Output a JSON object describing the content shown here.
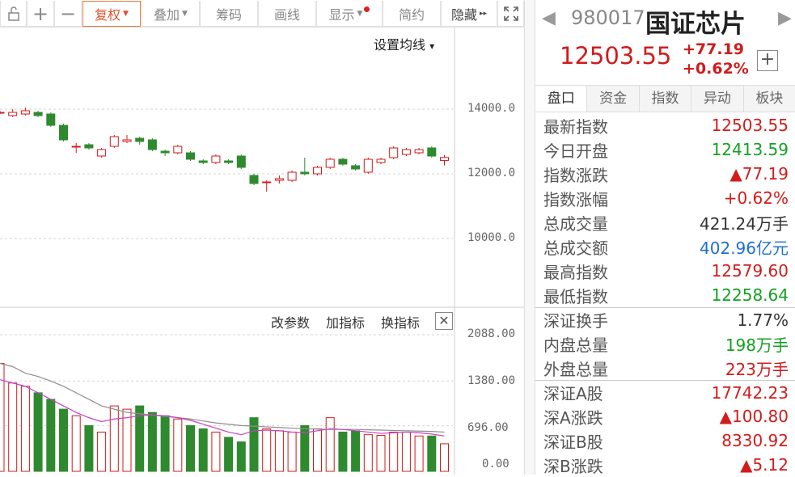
{
  "toolbar": {
    "items": [
      {
        "label": "复权",
        "caret": "▼"
      },
      {
        "label": "叠加",
        "caret": "▼"
      },
      {
        "label": "筹码"
      },
      {
        "label": "画线"
      },
      {
        "label": "显示",
        "caret": "▼"
      },
      {
        "label": "简约"
      },
      {
        "label": "隐藏",
        "caret": "▸▸"
      }
    ]
  },
  "chart": {
    "ma_option": "设置均线",
    "ma_caret": "▾",
    "vol_links": [
      "改参数",
      "加指标",
      "换指标"
    ],
    "close_glyph": "✕",
    "price_ticks": [
      "14000.0",
      "12000.0",
      "10000.0"
    ],
    "volume_ticks": [
      "2088.00",
      "1380.00",
      "696.00",
      "0.00"
    ]
  },
  "chart_data": {
    "type": "candlestick",
    "price_axis": {
      "ticks": [
        14000,
        12000,
        10000
      ],
      "range": [
        9000,
        15300
      ]
    },
    "volume_axis": {
      "ticks": [
        0,
        696,
        1380,
        2088
      ],
      "range": [
        0,
        2200
      ]
    },
    "candles": [
      {
        "o": 13900,
        "c": 13900,
        "h": 13950,
        "l": 13850
      },
      {
        "o": 13800,
        "c": 13900,
        "h": 14000,
        "l": 13750
      },
      {
        "o": 13850,
        "c": 13950,
        "h": 14050,
        "l": 13800
      },
      {
        "o": 13900,
        "c": 13800,
        "h": 13950,
        "l": 13750
      },
      {
        "o": 13850,
        "c": 13500,
        "h": 13900,
        "l": 13450
      },
      {
        "o": 13500,
        "c": 13050,
        "h": 13550,
        "l": 13000
      },
      {
        "o": 12850,
        "c": 12850,
        "h": 12950,
        "l": 12650
      },
      {
        "o": 12900,
        "c": 12800,
        "h": 12950,
        "l": 12750
      },
      {
        "o": 12550,
        "c": 12750,
        "h": 12800,
        "l": 12500
      },
      {
        "o": 12850,
        "c": 13150,
        "h": 13200,
        "l": 12800
      },
      {
        "o": 13000,
        "c": 13050,
        "h": 13200,
        "l": 12950
      },
      {
        "o": 13100,
        "c": 13000,
        "h": 13150,
        "l": 12900
      },
      {
        "o": 13050,
        "c": 12750,
        "h": 13100,
        "l": 12700
      },
      {
        "o": 12700,
        "c": 12650,
        "h": 12750,
        "l": 12550
      },
      {
        "o": 12650,
        "c": 12850,
        "h": 12900,
        "l": 12600
      },
      {
        "o": 12650,
        "c": 12450,
        "h": 12700,
        "l": 12400
      },
      {
        "o": 12400,
        "c": 12350,
        "h": 12450,
        "l": 12300
      },
      {
        "o": 12350,
        "c": 12550,
        "h": 12600,
        "l": 12300
      },
      {
        "o": 12400,
        "c": 12350,
        "h": 12450,
        "l": 12300
      },
      {
        "o": 12550,
        "c": 12200,
        "h": 12600,
        "l": 12150
      },
      {
        "o": 11950,
        "c": 11700,
        "h": 12000,
        "l": 11650
      },
      {
        "o": 11750,
        "c": 11750,
        "h": 11800,
        "l": 11450
      },
      {
        "o": 11800,
        "c": 11850,
        "h": 11950,
        "l": 11700
      },
      {
        "o": 11800,
        "c": 12050,
        "h": 12100,
        "l": 11750
      },
      {
        "o": 12050,
        "c": 12000,
        "h": 12500,
        "l": 11950
      },
      {
        "o": 12000,
        "c": 12200,
        "h": 12250,
        "l": 11950
      },
      {
        "o": 12200,
        "c": 12450,
        "h": 12500,
        "l": 12150
      },
      {
        "o": 12450,
        "c": 12300,
        "h": 12500,
        "l": 12250
      },
      {
        "o": 12250,
        "c": 12150,
        "h": 12300,
        "l": 12100
      },
      {
        "o": 12050,
        "c": 12450,
        "h": 12500,
        "l": 12000
      },
      {
        "o": 12350,
        "c": 12450,
        "h": 12500,
        "l": 12300
      },
      {
        "o": 12500,
        "c": 12800,
        "h": 12850,
        "l": 12450
      },
      {
        "o": 12600,
        "c": 12750,
        "h": 12800,
        "l": 12550
      },
      {
        "o": 12650,
        "c": 12750,
        "h": 12800,
        "l": 12600
      },
      {
        "o": 12800,
        "c": 12550,
        "h": 12850,
        "l": 12500
      },
      {
        "o": 12414,
        "c": 12504,
        "h": 12580,
        "l": 12259
      }
    ],
    "volumes": [
      1650,
      1350,
      1300,
      1200,
      1100,
      950,
      850,
      700,
      600,
      1000,
      950,
      1000,
      900,
      850,
      800,
      700,
      650,
      600,
      520,
      450,
      820,
      650,
      620,
      600,
      700,
      650,
      820,
      600,
      620,
      560,
      550,
      600,
      600,
      540,
      540,
      421
    ],
    "ma_lines": [
      {
        "color": "#8e8e8e",
        "values": [
          1650,
          1600,
          1500,
          1450,
          1380,
          1300,
          1200,
          1100,
          1000,
          950,
          900,
          880,
          860,
          840,
          820,
          800,
          770,
          740,
          720,
          700,
          690,
          680,
          670,
          660,
          650,
          645,
          640,
          640,
          640,
          635,
          630,
          625,
          620,
          615,
          610,
          600
        ]
      },
      {
        "color": "#c640c6",
        "values": [
          1400,
          1350,
          1300,
          1200,
          1100,
          1000,
          900,
          820,
          760,
          800,
          820,
          850,
          860,
          850,
          820,
          780,
          720,
          660,
          600,
          560,
          620,
          630,
          620,
          600,
          590,
          620,
          650,
          640,
          620,
          600,
          580,
          590,
          600,
          590,
          570,
          540
        ]
      }
    ],
    "colors": {
      "up": "#d21b1b",
      "down": "#2f8a2f"
    }
  },
  "quote": {
    "code": "980017",
    "name": "国证芯片",
    "nav_left": "◀",
    "nav_right": "▶",
    "price": "12503.55",
    "change": "+77.19",
    "change_pct": "+0.62%",
    "add_glyph": "+"
  },
  "tabs": [
    {
      "label": "盘口",
      "active": true
    },
    {
      "label": "资金"
    },
    {
      "label": "指数"
    },
    {
      "label": "异动"
    },
    {
      "label": "板块"
    }
  ],
  "stats": [
    {
      "label": "最新指数",
      "value": "12503.55",
      "color": "red"
    },
    {
      "label": "今日开盘",
      "value": "12413.59",
      "color": "green"
    },
    {
      "label": "指数涨跌",
      "value": "▲77.19",
      "color": "red"
    },
    {
      "label": "指数涨幅",
      "value": "+0.62%",
      "color": "red"
    },
    {
      "label": "总成交量",
      "value": "421.24万手",
      "color": "dark"
    },
    {
      "label": "总成交额",
      "value": "402.96亿元",
      "color": "blue"
    },
    {
      "label": "最高指数",
      "value": "12579.60",
      "color": "red"
    },
    {
      "label": "最低指数",
      "value": "12258.64",
      "color": "green"
    },
    {
      "label": "深证换手",
      "value": "1.77%",
      "color": "dark",
      "sep": true
    },
    {
      "label": "内盘总量",
      "value": "198万手",
      "color": "green"
    },
    {
      "label": "外盘总量",
      "value": "223万手",
      "color": "red"
    },
    {
      "label": "深证A股",
      "value": "17742.23",
      "color": "red",
      "sep": true
    },
    {
      "label": "深A涨跌",
      "value": "▲100.80",
      "color": "red"
    },
    {
      "label": "深证B股",
      "value": "8330.92",
      "color": "red"
    },
    {
      "label": "深B涨跌",
      "value": "▲5.12",
      "color": "red"
    }
  ]
}
